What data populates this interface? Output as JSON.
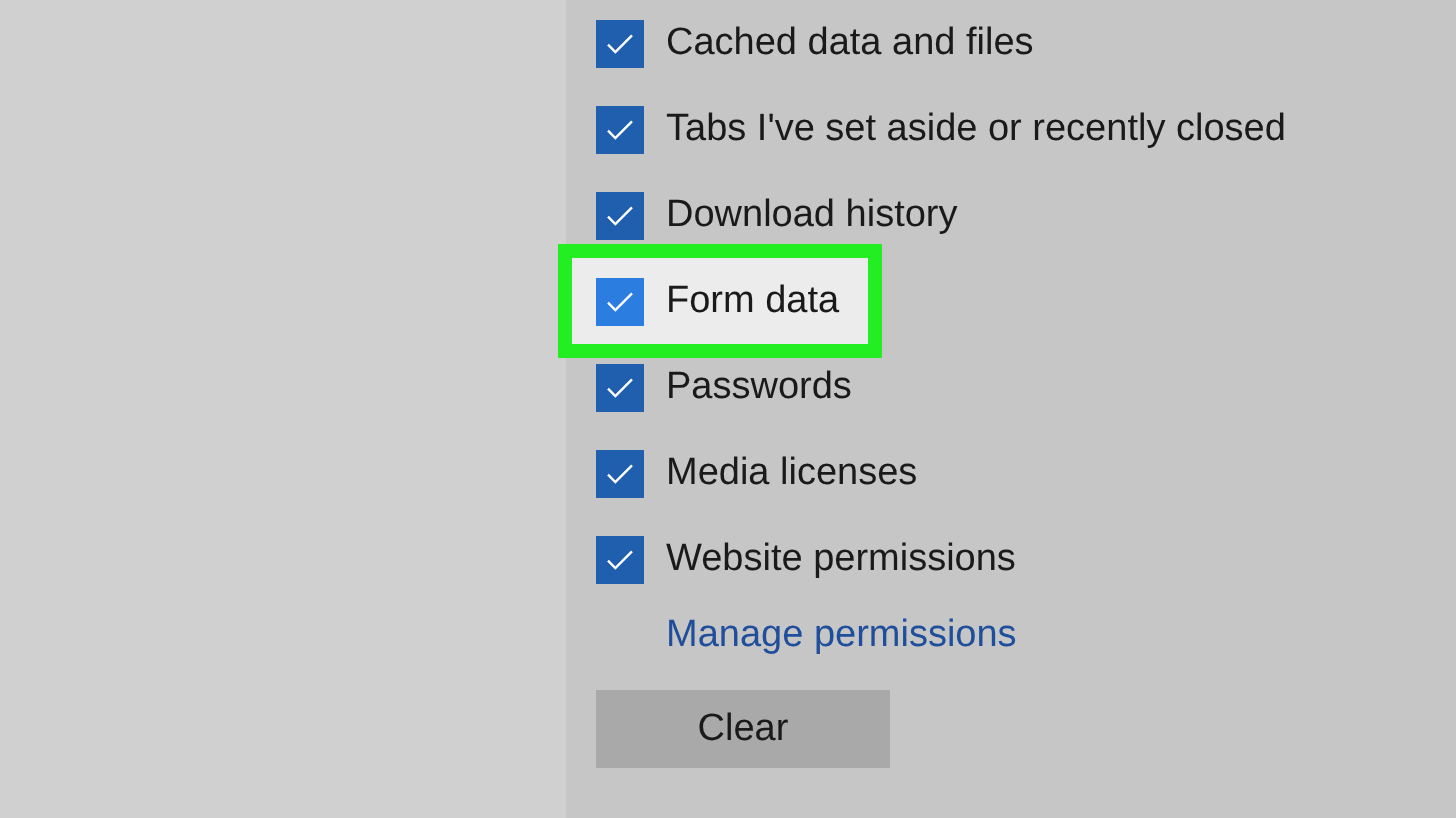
{
  "options": [
    {
      "label": "Cached data and files",
      "checked": true,
      "highlighted": false
    },
    {
      "label": "Tabs I've set aside or recently closed",
      "checked": true,
      "highlighted": false
    },
    {
      "label": "Download history",
      "checked": true,
      "highlighted": false
    },
    {
      "label": "Form data",
      "checked": true,
      "highlighted": true
    },
    {
      "label": "Passwords",
      "checked": true,
      "highlighted": false
    },
    {
      "label": "Media licenses",
      "checked": true,
      "highlighted": false
    },
    {
      "label": "Website permissions",
      "checked": true,
      "highlighted": false
    }
  ],
  "link": "Manage permissions",
  "button": "Clear"
}
